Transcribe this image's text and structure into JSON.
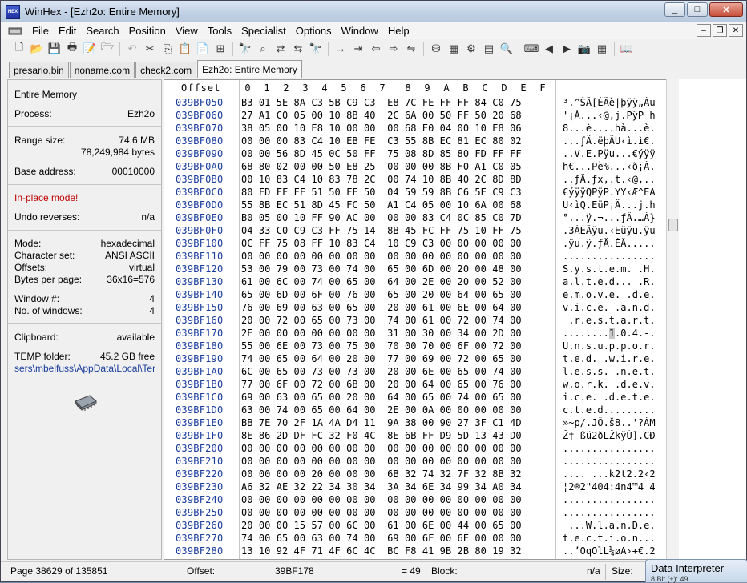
{
  "window": {
    "title": "WinHex - [Ezh2o: Entire Memory]",
    "logo_text": "HEX",
    "controls": [
      "_",
      "□",
      "✕"
    ]
  },
  "menu": [
    "File",
    "Edit",
    "Search",
    "Position",
    "View",
    "Tools",
    "Specialist",
    "Options",
    "Window",
    "Help"
  ],
  "tabs": [
    "presario.bin",
    "noname.com",
    "check2.com",
    "Ezh2o: Entire Memory"
  ],
  "info": {
    "title": "Entire Memory",
    "process_label": "Process:",
    "process_value": "Ezh2o",
    "range_label": "Range size:",
    "range_mb": "74.6 MB",
    "range_bytes": "78,249,984 bytes",
    "base_label": "Base address:",
    "base_value": "00010000",
    "inplace": "In-place mode!",
    "undo_label": "Undo reverses:",
    "undo_value": "n/a",
    "mode_label": "Mode:",
    "mode_value": "hexadecimal",
    "charset_label": "Character set:",
    "charset_value": "ANSI ASCII",
    "offsets_label": "Offsets:",
    "offsets_value": "virtual",
    "bpp_label": "Bytes per page:",
    "bpp_value": "36x16=576",
    "winno_label": "Window #:",
    "winno_value": "4",
    "nowin_label": "No. of windows:",
    "nowin_value": "4",
    "clip_label": "Clipboard:",
    "clip_value": "available",
    "temp_label": "TEMP folder:",
    "temp_value": "45.2 GB free",
    "temp_path": "sers\\mbeifuss\\AppData\\Local\\Temp"
  },
  "hex": {
    "offset_header": "Offset",
    "col_headers": [
      "0",
      "1",
      "2",
      "3",
      "4",
      "5",
      "6",
      "7",
      "8",
      "9",
      "A",
      "B",
      "C",
      "D",
      "E",
      "F"
    ],
    "rows": [
      {
        "off": "039BF050",
        "bytes": "B3 01 5E 8A C3 5B C9 C3  E8 7C FE FF FF 84 C0 75",
        "ascii": "³.^ŠÃ[ÉÃè|þÿÿ„Àu"
      },
      {
        "off": "039BF060",
        "bytes": "27 A1 C0 05 00 10 8B 40  2C 6A 00 50 FF 50 20 68",
        "ascii": "'¡À...‹@,j.PÿP h"
      },
      {
        "off": "039BF070",
        "bytes": "38 05 00 10 E8 10 00 00  00 68 E0 04 00 10 E8 06",
        "ascii": "8...è....hà...è."
      },
      {
        "off": "039BF080",
        "bytes": "00 00 00 83 C4 10 EB FE  C3 55 8B EC 81 EC 80 02",
        "ascii": "...ƒÄ.ëþÃU‹ì.ì€."
      },
      {
        "off": "039BF090",
        "bytes": "00 00 56 8D 45 0C 50 FF  75 08 8D 85 80 FD FF FF",
        "ascii": "..V.E.Pÿu...€ýÿÿ"
      },
      {
        "off": "039BF0A0",
        "bytes": "68 80 02 00 00 50 E8 25  00 00 00 8B F0 A1 C0 05",
        "ascii": "h€...Pè%...‹ð¡À."
      },
      {
        "off": "039BF0B0",
        "bytes": "00 10 83 C4 10 83 78 2C  00 74 10 8B 40 2C 8D 8D",
        "ascii": "..ƒÄ.ƒx,.t.‹@,.."
      },
      {
        "off": "039BF0C0",
        "bytes": "80 FD FF FF 51 50 FF 50  04 59 59 8B C6 5E C9 C3",
        "ascii": "€ýÿÿQPÿP.YY‹Æ^ÉÃ"
      },
      {
        "off": "039BF0D0",
        "bytes": "55 8B EC 51 8D 45 FC 50  A1 C4 05 00 10 6A 00 68",
        "ascii": "U‹ìQ.EüP¡Ä...j.h"
      },
      {
        "off": "039BF0E0",
        "bytes": "B0 05 00 10 FF 90 AC 00  00 00 83 C4 0C 85 C0 7D",
        "ascii": "°...ÿ.¬...ƒÄ.…À}"
      },
      {
        "off": "039BF0F0",
        "bytes": "04 33 C0 C9 C3 FF 75 14  8B 45 FC FF 75 10 FF 75",
        "ascii": ".3ÀÉÃÿu.‹Eüÿu.ÿu"
      },
      {
        "off": "039BF100",
        "bytes": "0C FF 75 08 FF 10 83 C4  10 C9 C3 00 00 00 00 00",
        "ascii": ".ÿu.ÿ.ƒÄ.ÉÃ....."
      },
      {
        "off": "039BF110",
        "bytes": "00 00 00 00 00 00 00 00  00 00 00 00 00 00 00 00",
        "ascii": "................"
      },
      {
        "off": "039BF120",
        "bytes": "53 00 79 00 73 00 74 00  65 00 6D 00 20 00 48 00",
        "ascii": "S.y.s.t.e.m. .H."
      },
      {
        "off": "039BF130",
        "bytes": "61 00 6C 00 74 00 65 00  64 00 2E 00 20 00 52 00",
        "ascii": "a.l.t.e.d... .R."
      },
      {
        "off": "039BF140",
        "bytes": "65 00 6D 00 6F 00 76 00  65 00 20 00 64 00 65 00",
        "ascii": "e.m.o.v.e. .d.e."
      },
      {
        "off": "039BF150",
        "bytes": "76 00 69 00 63 00 65 00  20 00 61 00 6E 00 64 00",
        "ascii": "v.i.c.e. .a.n.d."
      },
      {
        "off": "039BF160",
        "bytes": "20 00 72 00 65 00 73 00  74 00 61 00 72 00 74 00",
        "ascii": " .r.e.s.t.a.r.t."
      },
      {
        "off": "039BF170",
        "bytes": "2E 00 00 00 00 00 00 00  31 00 30 00 34 00 2D 00",
        "ascii": "........1.0.4.-."
      },
      {
        "off": "039BF180",
        "bytes": "55 00 6E 00 73 00 75 00  70 00 70 00 6F 00 72 00",
        "ascii": "U.n.s.u.p.p.o.r."
      },
      {
        "off": "039BF190",
        "bytes": "74 00 65 00 64 00 20 00  77 00 69 00 72 00 65 00",
        "ascii": "t.e.d. .w.i.r.e."
      },
      {
        "off": "039BF1A0",
        "bytes": "6C 00 65 00 73 00 73 00  20 00 6E 00 65 00 74 00",
        "ascii": "l.e.s.s. .n.e.t."
      },
      {
        "off": "039BF1B0",
        "bytes": "77 00 6F 00 72 00 6B 00  20 00 64 00 65 00 76 00",
        "ascii": "w.o.r.k. .d.e.v."
      },
      {
        "off": "039BF1C0",
        "bytes": "69 00 63 00 65 00 20 00  64 00 65 00 74 00 65 00",
        "ascii": "i.c.e. .d.e.t.e."
      },
      {
        "off": "039BF1D0",
        "bytes": "63 00 74 00 65 00 64 00  2E 00 0A 00 00 00 00 00",
        "ascii": "c.t.e.d........."
      },
      {
        "off": "039BF1E0",
        "bytes": "BB 7E 70 2F 1A 4A D4 11  9A 38 00 90 27 3F C1 4D",
        "ascii": "»~p/.JÔ.š8..'?ÁM"
      },
      {
        "off": "039BF1F0",
        "bytes": "8E 86 2D DF FC 32 F0 4C  8E 6B FF D9 5D 13 43 D0",
        "ascii": "Ž†-ßü2ðLŽkÿÙ].CÐ"
      },
      {
        "off": "039BF200",
        "bytes": "00 00 00 00 00 00 00 00  00 00 00 00 00 00 00 00",
        "ascii": "................"
      },
      {
        "off": "039BF210",
        "bytes": "00 00 00 00 00 00 00 00  00 00 00 00 00 00 00 00",
        "ascii": "................"
      },
      {
        "off": "039BF220",
        "bytes": "00 00 00 00 20 00 00 00  6B 32 74 32 7F 32 8B 32",
        "ascii": ".... ...k2t2.2‹2"
      },
      {
        "off": "039BF230",
        "bytes": "A6 32 AE 32 22 34 30 34  3A 34 6E 34 99 34 A0 34",
        "ascii": "¦2®2\"404:4n4™4 4"
      },
      {
        "off": "039BF240",
        "bytes": "00 00 00 00 00 00 00 00  00 00 00 00 00 00 00 00",
        "ascii": "................"
      },
      {
        "off": "039BF250",
        "bytes": "00 00 00 00 00 00 00 00  00 00 00 00 00 00 00 00",
        "ascii": "................"
      },
      {
        "off": "039BF260",
        "bytes": "20 00 00 15 57 00 6C 00  61 00 6E 00 44 00 65 00",
        "ascii": " ...W.l.a.n.D.e."
      },
      {
        "off": "039BF270",
        "bytes": "74 00 65 00 63 00 74 00  69 00 6F 00 6E 00 00 00",
        "ascii": "t.e.c.t.i.o.n..."
      },
      {
        "off": "039BF280",
        "bytes": "13 10 92 4F 71 4F 6C 4C  BC F8 41 9B 2B 80 19 32",
        "ascii": "..’OqOlL¼øA›+€.2"
      }
    ]
  },
  "status": {
    "page": "Page 38629 of 135851",
    "offset_label": "Offset:",
    "offset_value": "39BF178",
    "eq": "= 49",
    "block_label": "Block:",
    "block_value": "n/a",
    "size_label": "Size:"
  },
  "data_interpreter": {
    "title": "Data Interpreter",
    "sub": "8 Bit (±): 49"
  }
}
